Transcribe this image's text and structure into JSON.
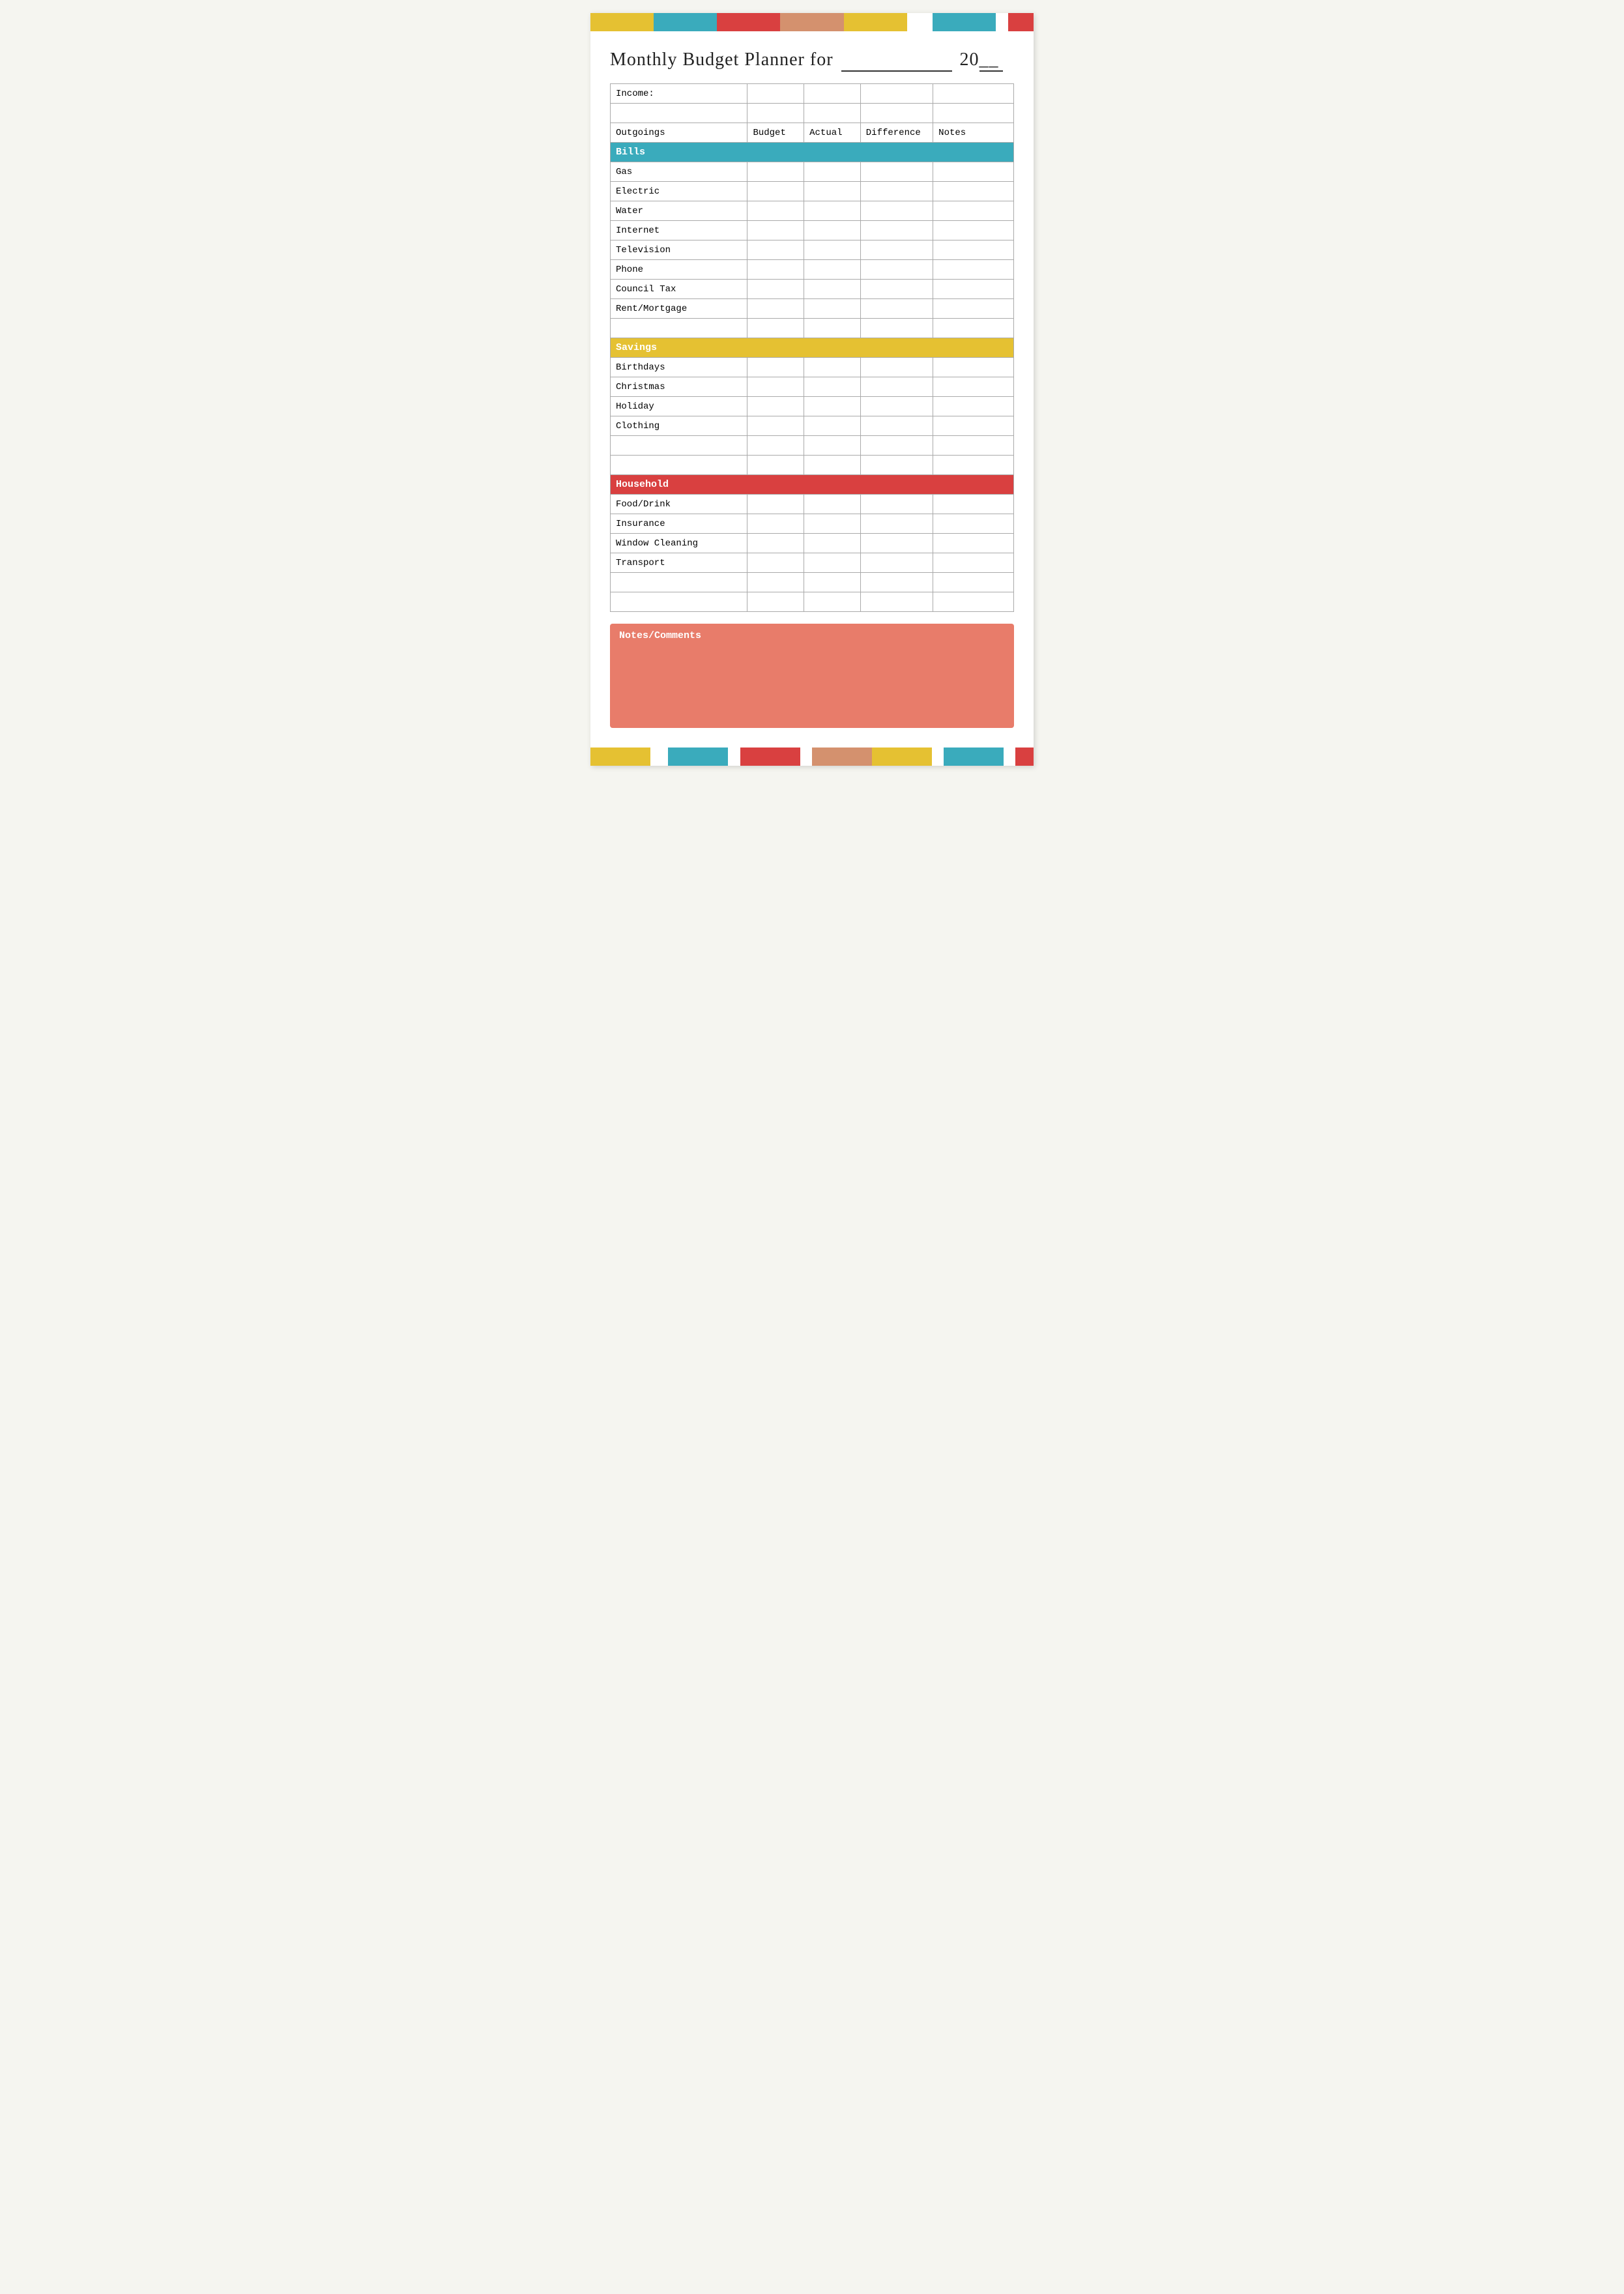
{
  "title": {
    "prefix": "Monthly Budget Planner for",
    "underscore": "___________",
    "year_prefix": "20",
    "year_suffix": "__"
  },
  "color_bars_top": [
    {
      "color": "#e5c132",
      "flex": 2
    },
    {
      "color": "#3aabbc",
      "flex": 2
    },
    {
      "color": "#d94040",
      "flex": 2
    },
    {
      "color": "#d4916e",
      "flex": 2
    },
    {
      "color": "#e5c132",
      "flex": 2
    },
    {
      "color": "#fff",
      "flex": 1
    },
    {
      "color": "#3aabbc",
      "flex": 2
    },
    {
      "color": "#fff",
      "flex": 1
    },
    {
      "color": "#d94040",
      "flex": 1
    }
  ],
  "color_bars_bottom": [
    {
      "color": "#e5c132",
      "flex": 2
    },
    {
      "color": "#fff",
      "flex": 1
    },
    {
      "color": "#3aabbc",
      "flex": 2
    },
    {
      "color": "#fff",
      "flex": 0.5
    },
    {
      "color": "#d94040",
      "flex": 2
    },
    {
      "color": "#fff",
      "flex": 0.5
    },
    {
      "color": "#d4916e",
      "flex": 2
    },
    {
      "color": "#e5c132",
      "flex": 2
    },
    {
      "color": "#fff",
      "flex": 0.5
    },
    {
      "color": "#3aabbc",
      "flex": 2
    },
    {
      "color": "#fff",
      "flex": 0.5
    },
    {
      "color": "#d94040",
      "flex": 0.5
    }
  ],
  "table": {
    "income_label": "Income:",
    "columns": {
      "outgoings": "Outgoings",
      "budget": "Budget",
      "actual": "Actual",
      "difference": "Difference",
      "notes": "Notes"
    },
    "sections": [
      {
        "name": "Bills",
        "color": "bills",
        "rows": [
          "Gas",
          "Electric",
          "Water",
          "Internet",
          "Television",
          "Phone",
          "Council Tax",
          "Rent/Mortgage",
          "",
          ""
        ]
      },
      {
        "name": "Savings",
        "color": "savings",
        "rows": [
          "Birthdays",
          "Christmas",
          "Holiday",
          "Clothing",
          "",
          ""
        ]
      },
      {
        "name": "Household",
        "color": "household",
        "rows": [
          "Food/Drink",
          "Insurance",
          "Window Cleaning",
          "Transport",
          "",
          ""
        ]
      }
    ]
  },
  "notes_comments": {
    "label": "Notes/Comments"
  }
}
